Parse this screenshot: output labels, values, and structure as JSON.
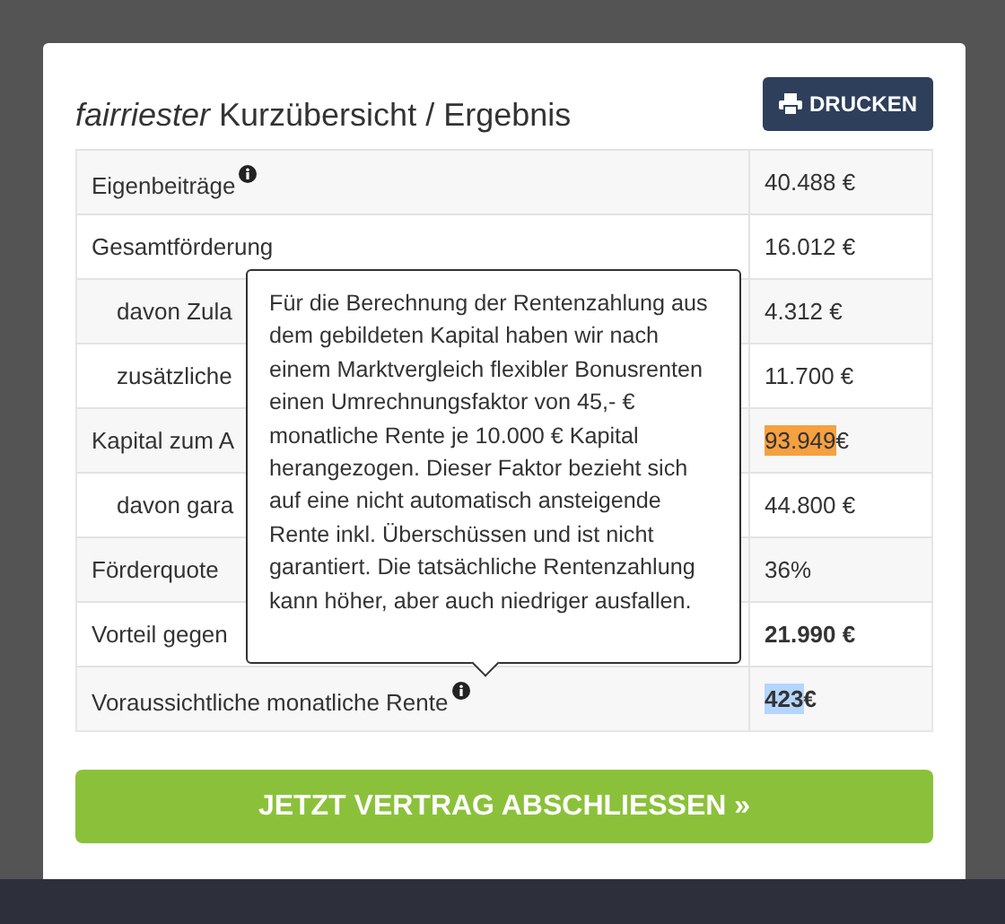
{
  "title": "*fairriester* Kurzübersicht / Ergebnis",
  "print_button": "DRUCKEN",
  "rows": [
    {
      "label": "Eigenbeiträge",
      "info": true,
      "value": "40.488 €",
      "bold": false
    },
    {
      "label": "Gesamtförderung",
      "info": false,
      "value": "16.012 €",
      "bold": false,
      "children": [
        {
          "label": "davon Zula",
          "info": false,
          "value": "4.312 €",
          "bold": false
        },
        {
          "label": "zusätzliche",
          "info": false,
          "value": "11.700 €",
          "bold": false
        }
      ]
    },
    {
      "label": "Kapital zum A",
      "info": false,
      "mark": {
        "text": "93.949",
        "color": "#f5a041"
      },
      "value": "€",
      "bold": false,
      "children": [
        {
          "label": "davon gara",
          "info": false,
          "value": "44.800 €",
          "bold": false
        }
      ]
    },
    {
      "label": "Förderquote",
      "info": false,
      "value": "36%",
      "bold": false
    },
    {
      "label": "Vorteil gegen",
      "info": false,
      "value": "21.990 €",
      "bold": true
    },
    {
      "label": "Voraussichtliche monatliche Rente",
      "info": true,
      "mark": {
        "text": "423",
        "color": "#b4d5fe"
      },
      "value": "€",
      "bold": true
    }
  ],
  "tooltip": "Für die Berechnung der Rentenzahlung aus dem gebildeten Kapital haben wir nach einem Marktvergleich flexibler Bonusrenten einen Umrechnungsfaktor von 45,- € monatliche Rente je 10.000 € Kapital herangezogen. Dieser Faktor bezieht sich auf eine nicht automatisch ansteigende Rente inkl. Überschüssen und ist nicht garantiert. Die tatsächliche Rentenzahlung kann höher, aber auch niedriger ausfallen.",
  "cta_button": "JETZT VERTRAG ABSCHLIESSEN »"
}
